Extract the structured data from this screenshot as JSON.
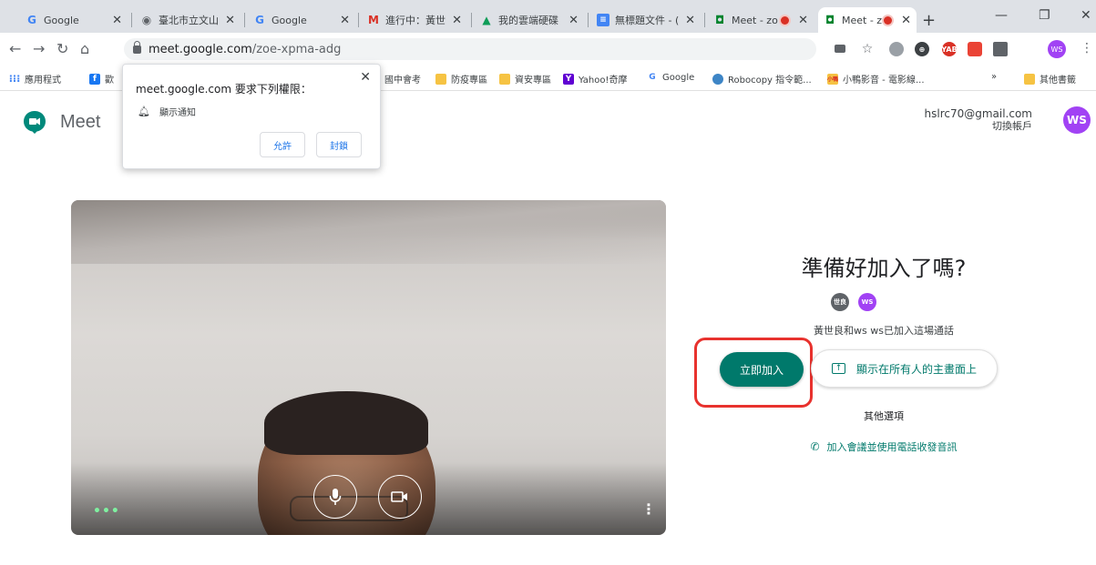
{
  "browser": {
    "tabs": [
      {
        "title": "Google",
        "favicon": "google-g"
      },
      {
        "title": "臺北市立文山",
        "favicon": "globe"
      },
      {
        "title": "Google",
        "favicon": "google-g"
      },
      {
        "title": "進行中：黃世",
        "favicon": "gmail"
      },
      {
        "title": "我的雲端硬碟",
        "favicon": "drive"
      },
      {
        "title": "無標題文件 - (",
        "favicon": "docs"
      },
      {
        "title": "Meet - zo",
        "favicon": "meet"
      },
      {
        "title": "Meet - zo",
        "favicon": "meet"
      }
    ],
    "url_host": "meet.google.com",
    "url_path": "/zoe-xpma-adg",
    "profile_initials": "WS"
  },
  "bookmarks": [
    {
      "label": "應用程式",
      "icon": "apps-grid"
    },
    {
      "label": "歡",
      "icon": "facebook"
    },
    {
      "label": "國中會考",
      "icon": "folder"
    },
    {
      "label": "防疫專區",
      "icon": "folder"
    },
    {
      "label": "資安專區",
      "icon": "folder"
    },
    {
      "label": "Yahoo!奇摩",
      "icon": "yahoo"
    },
    {
      "label": "Google",
      "icon": "google-g"
    },
    {
      "label": "Robocopy 指令範...",
      "icon": "robocopy"
    },
    {
      "label": "小鴨影音 - 電影線...",
      "icon": "duck"
    },
    {
      "label": "»",
      "icon": "more"
    },
    {
      "label": "其他書籤",
      "icon": "folder"
    }
  ],
  "permission_popup": {
    "title": "meet.google.com 要求下列權限：",
    "permission": "顯示通知",
    "allow_label": "允許",
    "block_label": "封鎖"
  },
  "meet": {
    "brand": "Meet",
    "account_email": "hslrc70@gmail.com",
    "switch_account": "切換帳戶",
    "avatar_initials": "WS",
    "ready_title": "準備好加入了嗎?",
    "participant_avatars": [
      "世良",
      "WS"
    ],
    "participants_text": "黃世良和ws ws已加入這場通話",
    "join_label": "立即加入",
    "present_label": "顯示在所有人的主畫面上",
    "other_options": "其他選項",
    "phone_option": "加入會議並使用電話收發音訊"
  },
  "colors": {
    "accent": "#00796b",
    "highlight": "#e8322e",
    "profile": "#a142f4"
  }
}
